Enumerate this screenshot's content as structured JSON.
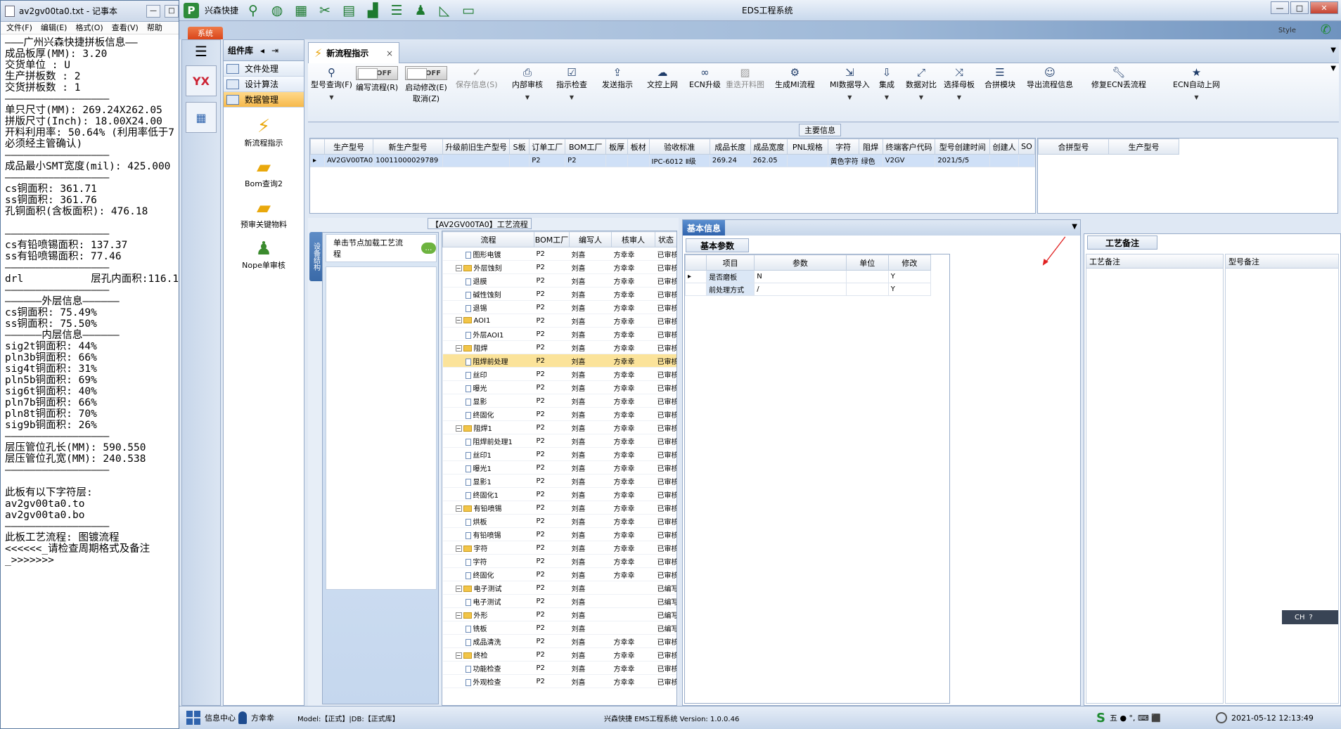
{
  "notepad": {
    "title": "av2gv00ta0.txt - 记事本",
    "menu": [
      "文件(F)",
      "编辑(E)",
      "格式(O)",
      "查看(V)",
      "帮助"
    ],
    "lines": [
      "———广州兴森快捷拼板信息——",
      "成品板厚(MM): 3.20",
      "交货单位 : U",
      "生产拼板数 : 2",
      "交货拼板数 : 1",
      "—————————————————",
      "单只尺寸(MM): 269.24X262.05",
      "拼版尺寸(Inch): 18.00X24.00",
      "开料利用率: 50.64% (利用率低于7",
      "必须经主管确认)",
      "—————————————————",
      "成品最小SMT宽度(mil): 425.000",
      "—————————————————",
      "cs铜面积: 361.71",
      "ss铜面积: 361.76",
      "孔铜面积(含板面积): 476.18",
      "",
      "—————————————————",
      "cs有铅喷锡面积: 137.37",
      "ss有铅喷锡面积: 77.46",
      "—————————————————",
      "drl           层孔内面积:116.10",
      "—————————————————",
      "——————外层信息——————",
      "cs铜面积: 75.49%",
      "ss铜面积: 75.50%",
      "——————内层信息——————",
      "sig2t铜面积: 44%",
      "pln3b铜面积: 66%",
      "sig4t铜面积: 31%",
      "pln5b铜面积: 69%",
      "sig6t铜面积: 40%",
      "pln7b铜面积: 66%",
      "pln8t铜面积: 70%",
      "sig9b铜面积: 26%",
      "—————————————————",
      "层压管位孔长(MM): 590.550",
      "层压管位孔宽(MM): 240.538",
      "—————————————————",
      "",
      "此板有以下字符层:",
      "av2gv00ta0.to",
      "av2gv00ta0.bo",
      "—————————————————",
      "此板工艺流程: 图镀流程",
      "<<<<<<_请检查周期格式及备注",
      "_>>>>>>>"
    ]
  },
  "app": {
    "brand": "兴森快捷",
    "title": "EDS工程系统",
    "style_label": "Style",
    "system_tab": "系统",
    "win": {
      "min": "—",
      "max": "□",
      "close": "✕"
    }
  },
  "component_lib": {
    "title": "组件库",
    "nav": [
      "文件处理",
      "设计算法",
      "数据管理"
    ],
    "tools": [
      "新流程指示",
      "Bom查询2",
      "预审关键物料",
      "Nope单审核"
    ],
    "strip_logo": "YX"
  },
  "doc_tab": {
    "label": "新流程指示",
    "close": "×"
  },
  "ribbon": {
    "query": "型号查询(F)",
    "write_flow": "编写流程(R)",
    "start_edit": "启动修改(E)",
    "cancel": "取消(Z)",
    "off": "OFF",
    "buttons": [
      "保存信息(S)",
      "内部审核",
      "指示检查",
      "发送指示",
      "文控上网",
      "ECN升级",
      "重迭开料图",
      "生成MI流程",
      "MI数据导入",
      "集成",
      "数据对比",
      "选择母板",
      "合拼模块",
      "导出流程信息",
      "修复ECN丢流程",
      "ECN自动上网"
    ]
  },
  "main_info": {
    "title": "主要信息",
    "columns": [
      "生产型号",
      "新生产型号",
      "升级前旧生产型号",
      "S板",
      "订单工厂",
      "BOM工厂",
      "板厚",
      "板材",
      "验收标准",
      "成品长度",
      "成品宽度",
      "PNL规格",
      "字符",
      "阻焊",
      "终端客户代码",
      "型号创建时间",
      "创建人",
      "SO"
    ],
    "row": [
      "AV2GV00TA0",
      "10011000029789",
      "",
      "",
      "P2",
      "P2",
      "",
      "",
      "IPC-6012 Ⅱ级",
      "269.24",
      "262.05",
      "",
      "黄色字符",
      "绿色",
      "V2GV",
      "2021/5/5",
      "",
      ""
    ],
    "side_columns": [
      "合拼型号",
      "生产型号"
    ]
  },
  "process": {
    "title": "【AV2GV00TA0】工艺流程",
    "vertical_tab": "设备结构",
    "hint": "单击节点加载工艺流程",
    "columns": [
      "流程",
      "BOM工厂",
      "编写人",
      "核审人",
      "状态"
    ],
    "rows": [
      {
        "name": "图形电镀",
        "lvl": 2,
        "t": "doc",
        "f": "P2",
        "w": "刘喜",
        "r": "方幸幸",
        "s": "已审核"
      },
      {
        "name": "外层蚀刻",
        "lvl": 1,
        "t": "fold",
        "f": "P2",
        "w": "刘喜",
        "r": "方幸幸",
        "s": "已审核"
      },
      {
        "name": "退膜",
        "lvl": 2,
        "t": "doc",
        "f": "P2",
        "w": "刘喜",
        "r": "方幸幸",
        "s": "已审核"
      },
      {
        "name": "碱性蚀刻",
        "lvl": 2,
        "t": "doc",
        "f": "P2",
        "w": "刘喜",
        "r": "方幸幸",
        "s": "已审核"
      },
      {
        "name": "退锡",
        "lvl": 2,
        "t": "doc",
        "f": "P2",
        "w": "刘喜",
        "r": "方幸幸",
        "s": "已审核"
      },
      {
        "name": "AOI1",
        "lvl": 1,
        "t": "fold",
        "f": "P2",
        "w": "刘喜",
        "r": "方幸幸",
        "s": "已审核"
      },
      {
        "name": "外层AOI1",
        "lvl": 2,
        "t": "doc",
        "f": "P2",
        "w": "刘喜",
        "r": "方幸幸",
        "s": "已审核"
      },
      {
        "name": "阻焊",
        "lvl": 1,
        "t": "fold",
        "f": "P2",
        "w": "刘喜",
        "r": "方幸幸",
        "s": "已审核"
      },
      {
        "name": "阻焊前处理",
        "lvl": 2,
        "t": "doc",
        "f": "P2",
        "w": "刘喜",
        "r": "方幸幸",
        "s": "已审核",
        "hl": true
      },
      {
        "name": "丝印",
        "lvl": 2,
        "t": "doc",
        "f": "P2",
        "w": "刘喜",
        "r": "方幸幸",
        "s": "已审核"
      },
      {
        "name": "曝光",
        "lvl": 2,
        "t": "doc",
        "f": "P2",
        "w": "刘喜",
        "r": "方幸幸",
        "s": "已审核"
      },
      {
        "name": "显影",
        "lvl": 2,
        "t": "doc",
        "f": "P2",
        "w": "刘喜",
        "r": "方幸幸",
        "s": "已审核"
      },
      {
        "name": "终固化",
        "lvl": 2,
        "t": "doc",
        "f": "P2",
        "w": "刘喜",
        "r": "方幸幸",
        "s": "已审核"
      },
      {
        "name": "阻焊1",
        "lvl": 1,
        "t": "fold",
        "f": "P2",
        "w": "刘喜",
        "r": "方幸幸",
        "s": "已审核"
      },
      {
        "name": "阻焊前处理1",
        "lvl": 2,
        "t": "doc",
        "f": "P2",
        "w": "刘喜",
        "r": "方幸幸",
        "s": "已审核"
      },
      {
        "name": "丝印1",
        "lvl": 2,
        "t": "doc",
        "f": "P2",
        "w": "刘喜",
        "r": "方幸幸",
        "s": "已审核"
      },
      {
        "name": "曝光1",
        "lvl": 2,
        "t": "doc",
        "f": "P2",
        "w": "刘喜",
        "r": "方幸幸",
        "s": "已审核"
      },
      {
        "name": "显影1",
        "lvl": 2,
        "t": "doc",
        "f": "P2",
        "w": "刘喜",
        "r": "方幸幸",
        "s": "已审核"
      },
      {
        "name": "终固化1",
        "lvl": 2,
        "t": "doc",
        "f": "P2",
        "w": "刘喜",
        "r": "方幸幸",
        "s": "已审核"
      },
      {
        "name": "有铅喷锡",
        "lvl": 1,
        "t": "fold",
        "f": "P2",
        "w": "刘喜",
        "r": "方幸幸",
        "s": "已审核"
      },
      {
        "name": "烘板",
        "lvl": 2,
        "t": "doc",
        "f": "P2",
        "w": "刘喜",
        "r": "方幸幸",
        "s": "已审核"
      },
      {
        "name": "有铅喷锡",
        "lvl": 2,
        "t": "doc",
        "f": "P2",
        "w": "刘喜",
        "r": "方幸幸",
        "s": "已审核"
      },
      {
        "name": "字符",
        "lvl": 1,
        "t": "fold",
        "f": "P2",
        "w": "刘喜",
        "r": "方幸幸",
        "s": "已审核"
      },
      {
        "name": "字符",
        "lvl": 2,
        "t": "doc",
        "f": "P2",
        "w": "刘喜",
        "r": "方幸幸",
        "s": "已审核"
      },
      {
        "name": "终固化",
        "lvl": 2,
        "t": "doc",
        "f": "P2",
        "w": "刘喜",
        "r": "方幸幸",
        "s": "已审核"
      },
      {
        "name": "电子测试",
        "lvl": 1,
        "t": "fold",
        "f": "P2",
        "w": "刘喜",
        "r": "",
        "s": "已编写"
      },
      {
        "name": "电子测试",
        "lvl": 2,
        "t": "doc",
        "f": "P2",
        "w": "刘喜",
        "r": "",
        "s": "已编写"
      },
      {
        "name": "外形",
        "lvl": 1,
        "t": "fold",
        "f": "P2",
        "w": "刘喜",
        "r": "",
        "s": "已编写"
      },
      {
        "name": "铣板",
        "lvl": 2,
        "t": "doc",
        "f": "P2",
        "w": "刘喜",
        "r": "",
        "s": "已编写"
      },
      {
        "name": "成品清洗",
        "lvl": 2,
        "t": "doc",
        "f": "P2",
        "w": "刘喜",
        "r": "方幸幸",
        "s": "已审核"
      },
      {
        "name": "终检",
        "lvl": 1,
        "t": "fold",
        "f": "P2",
        "w": "刘喜",
        "r": "方幸幸",
        "s": "已审核"
      },
      {
        "name": "功能检查",
        "lvl": 2,
        "t": "doc",
        "f": "P2",
        "w": "刘喜",
        "r": "方幸幸",
        "s": "已审核"
      },
      {
        "name": "外观检查",
        "lvl": 2,
        "t": "doc",
        "f": "P2",
        "w": "刘喜",
        "r": "方幸幸",
        "s": "已审核"
      }
    ]
  },
  "basic_info": {
    "title": "基本信息",
    "sub_tab": "基本参数",
    "columns": [
      "项目",
      "参数",
      "单位",
      "修改"
    ],
    "rows": [
      [
        "是否磨板",
        "N",
        "",
        "Y"
      ],
      [
        "前处理方式",
        "/",
        "",
        "Y"
      ]
    ]
  },
  "craft": {
    "title": "工艺备注",
    "columns": [
      "工艺备注",
      "型号备注"
    ]
  },
  "ime": {
    "label": "CH",
    "help": "?"
  },
  "status": {
    "info_center": "信息中心",
    "user": "方幸幸",
    "model": "Model:【正式】|DB:【正式库】",
    "version": "兴森快捷 EMS工程系统 Version: 1.0.0.46",
    "ime_glyphs": "五 ● °, ⌨ ⬛",
    "datetime": "2021-05-12 12:13:49"
  },
  "colors": {
    "accent": "#2f63ad",
    "highlight": "#fbe39a",
    "selected": "#cfe0f7",
    "system_tab": "#e05a28"
  }
}
